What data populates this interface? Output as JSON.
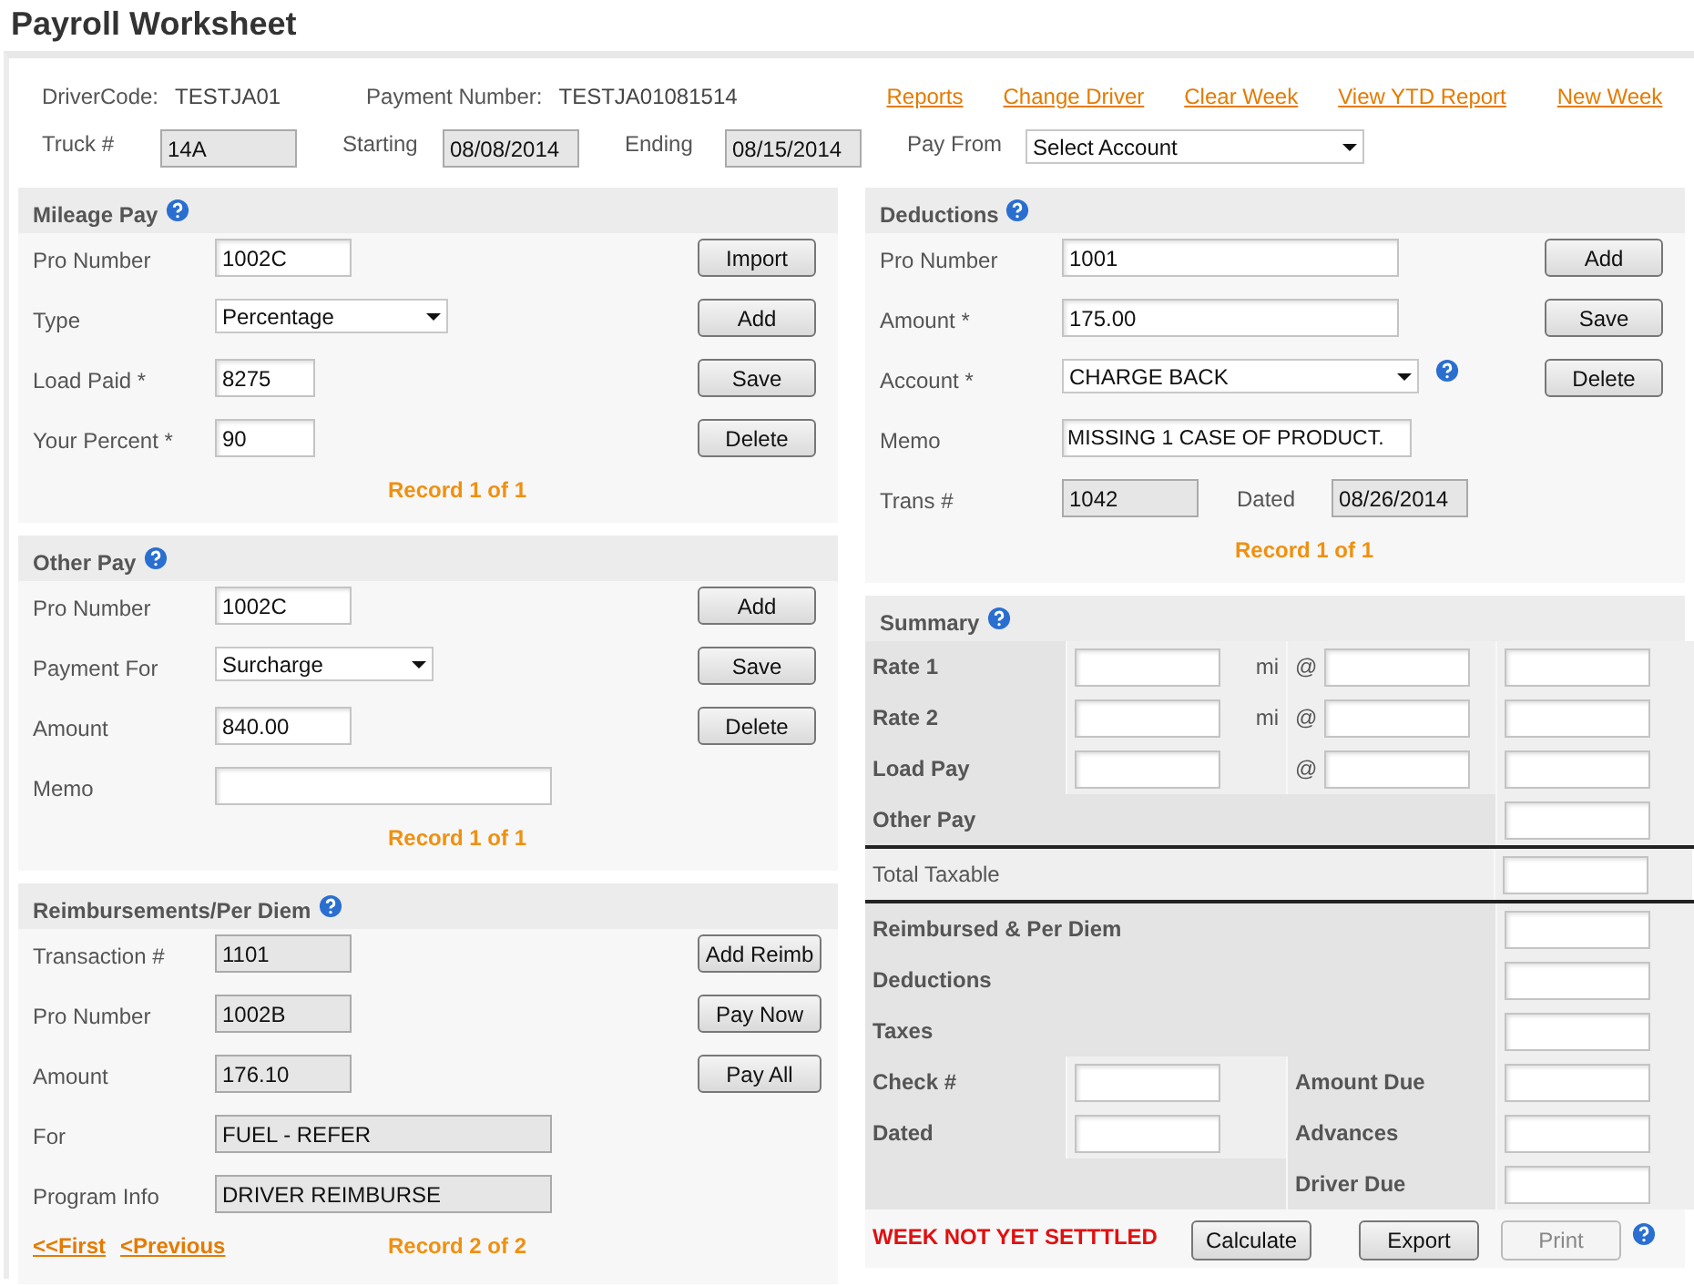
{
  "title": "Payroll Worksheet",
  "header": {
    "driver_label": "DriverCode:",
    "driver_value": "TESTJA01",
    "payment_label": "Payment Number:",
    "payment_value": "TESTJA01081514",
    "links": [
      "Reports",
      "Change Driver",
      "Clear Week",
      "View YTD Report",
      "New Week"
    ],
    "fields": [
      {
        "label": "Truck #",
        "value": "14A",
        "kind": "readonly"
      },
      {
        "label": "Starting",
        "value": "08/08/2014",
        "kind": "readonly"
      },
      {
        "label": "Ending",
        "value": "08/15/2014",
        "kind": "readonly"
      },
      {
        "label": "Pay From",
        "value": "Select Account",
        "kind": "select"
      }
    ]
  },
  "left": [
    {
      "title": "Mileage Pay",
      "fields": [
        {
          "label": "Pro Number",
          "value": "1002C",
          "kind": "text"
        },
        {
          "label": "Type",
          "value": "Percentage",
          "kind": "select"
        },
        {
          "label": "Load Paid *",
          "value": "8275",
          "kind": "text"
        },
        {
          "label": "Your Percent *",
          "value": "90",
          "kind": "text"
        }
      ],
      "buttons": [
        {
          "label": "Import",
          "disabled": false
        },
        {
          "label": "Add",
          "disabled": false
        },
        {
          "label": "Save",
          "disabled": false
        },
        {
          "label": "Delete",
          "disabled": false
        }
      ],
      "record": "Record 1 of 1"
    },
    {
      "title": "Other Pay",
      "fields": [
        {
          "label": "Pro Number",
          "value": "1002C",
          "kind": "text"
        },
        {
          "label": "Payment For",
          "value": "Surcharge",
          "kind": "select"
        },
        {
          "label": "Amount",
          "value": "840.00",
          "kind": "text"
        },
        {
          "label": "Memo",
          "kind": "text"
        }
      ],
      "buttons": [
        {
          "label": "Add",
          "disabled": false
        },
        {
          "label": "Save",
          "disabled": false
        },
        {
          "label": "Delete",
          "disabled": false
        }
      ],
      "record": "Record 1 of 1"
    },
    {
      "title": "Reimbursements/Per Diem",
      "fields": [
        {
          "label": "Transaction #",
          "value": "1101",
          "kind": "readonly"
        },
        {
          "label": "Pro Number",
          "value": "1002B",
          "kind": "readonly"
        },
        {
          "label": "Amount",
          "value": "176.10",
          "kind": "readonly"
        },
        {
          "label": "For",
          "value": "FUEL - REFER",
          "kind": "readonly"
        },
        {
          "label": "Program Info",
          "value": "DRIVER REIMBURSE",
          "kind": "readonly"
        }
      ],
      "buttons": [
        {
          "label": "Add Reimb",
          "disabled": false
        },
        {
          "label": "Pay Now",
          "disabled": false
        },
        {
          "label": "Pay All",
          "disabled": false
        }
      ],
      "nav": [
        "<<First",
        "<Previous"
      ],
      "record": "Record 2 of 2"
    }
  ],
  "deductions": {
    "title": "Deductions",
    "fields": [
      {
        "label": "Pro Number",
        "value": "1001",
        "kind": "text"
      },
      {
        "label": "Amount *",
        "value": "175.00",
        "kind": "text"
      },
      {
        "label": "Account *",
        "value": "CHARGE BACK",
        "kind": "select",
        "help": true
      },
      {
        "label": "Memo",
        "value": "MISSING 1 CASE OF PRODUCT.",
        "kind": "text"
      },
      {
        "label": "Trans #",
        "value": "1042",
        "kind": "readonly",
        "pair": {
          "label": "Dated",
          "value": "08/26/2014",
          "kind": "readonly"
        }
      }
    ],
    "buttons": [
      {
        "label": "Add",
        "disabled": false
      },
      {
        "label": "Save",
        "disabled": false
      },
      {
        "label": "Delete",
        "disabled": false
      }
    ],
    "record": "Record 1 of 1"
  },
  "summary": {
    "title": "Summary",
    "rows": [
      {
        "kind": "rate",
        "label": "Rate 1",
        "unit": "mi",
        "at": "@"
      },
      {
        "kind": "rate",
        "label": "Rate 2",
        "unit": "mi",
        "at": "@"
      },
      {
        "kind": "rate",
        "label": "Load Pay",
        "at": "@"
      },
      {
        "kind": "plain",
        "label": "Other Pay"
      },
      {
        "kind": "total",
        "label": "Total Taxable"
      },
      {
        "kind": "plain",
        "label": "Reimbursed & Per Diem"
      },
      {
        "kind": "plain",
        "label": "Deductions"
      },
      {
        "kind": "plain",
        "label": "Taxes"
      },
      {
        "kind": "split",
        "label": "Check #",
        "sublabel": "Amount Due"
      },
      {
        "kind": "split",
        "label": "Dated",
        "sublabel": "Advances"
      },
      {
        "kind": "sub",
        "sublabel": "Driver Due"
      }
    ],
    "status": "WEEK NOT YET SETTTLED",
    "buttons": [
      {
        "label": "Calculate",
        "disabled": false
      },
      {
        "label": "Export",
        "disabled": false
      },
      {
        "label": "Print",
        "disabled": true
      }
    ]
  }
}
